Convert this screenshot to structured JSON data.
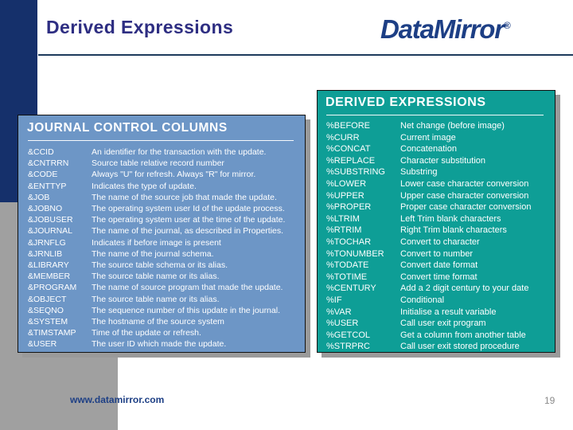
{
  "slide": {
    "title": "Derived Expressions"
  },
  "logo": {
    "name": "DataMirror",
    "registered_mark": "®",
    "color": "#1d3f85"
  },
  "journal_panel": {
    "title": "JOURNAL CONTROL COLUMNS",
    "background_color": "#6d96c6",
    "rows": [
      {
        "key": "&CCID",
        "desc": "An identifier for the transaction with the update."
      },
      {
        "key": "&CNTRRN",
        "desc": "Source table relative record number"
      },
      {
        "key": "&CODE",
        "desc": "Always \"U\" for refresh. Always \"R\" for mirror."
      },
      {
        "key": "&ENTTYP",
        "desc": "Indicates the type of update."
      },
      {
        "key": "&JOB",
        "desc": "The name of the source job that made the update."
      },
      {
        "key": "&JOBNO",
        "desc": "The operating system user Id of the update process."
      },
      {
        "key": "&JOBUSER",
        "desc": "The operating system user at the time of the update."
      },
      {
        "key": "&JOURNAL",
        "desc": "The name of the journal, as described in Properties."
      },
      {
        "key": "&JRNFLG",
        "desc": "Indicates if before image is present"
      },
      {
        "key": "&JRNLIB",
        "desc": "The name of the journal schema."
      },
      {
        "key": "&LIBRARY",
        "desc": "The source table schema or its alias."
      },
      {
        "key": "&MEMBER",
        "desc": "The source table name or its alias."
      },
      {
        "key": "&PROGRAM",
        "desc": "The name of source program that made the update."
      },
      {
        "key": "&OBJECT",
        "desc": "The source table name or its alias."
      },
      {
        "key": "&SEQNO",
        "desc": "The sequence number of this update in the journal."
      },
      {
        "key": "&SYSTEM",
        "desc": "The hostname of the source system"
      },
      {
        "key": "&TIMSTAMP",
        "desc": "Time of the update or refresh."
      },
      {
        "key": "&USER",
        "desc": "The user ID which made the update."
      }
    ]
  },
  "derived_panel": {
    "title": "DERIVED EXPRESSIONS",
    "background_color": "#0e9e96",
    "rows": [
      {
        "key": "%BEFORE",
        "desc": "Net change (before image)"
      },
      {
        "key": "%CURR",
        "desc": "Current image"
      },
      {
        "key": "%CONCAT",
        "desc": "Concatenation"
      },
      {
        "key": "%REPLACE",
        "desc": "Character substitution"
      },
      {
        "key": "%SUBSTRING",
        "desc": "Substring"
      },
      {
        "key": "%LOWER",
        "desc": "Lower case character conversion"
      },
      {
        "key": "%UPPER",
        "desc": "Upper case character conversion"
      },
      {
        "key": "%PROPER",
        "desc": "Proper case character conversion"
      },
      {
        "key": "%LTRIM",
        "desc": "Left Trim blank characters"
      },
      {
        "key": "%RTRIM",
        "desc": "Right Trim blank characters"
      },
      {
        "key": "%TOCHAR",
        "desc": "Convert to character"
      },
      {
        "key": "%TONUMBER",
        "desc": "Convert to number"
      },
      {
        "key": "%TODATE",
        "desc": "Convert date format"
      },
      {
        "key": "%TOTIME",
        "desc": "Convert time format"
      },
      {
        "key": "%CENTURY",
        "desc": "Add a 2 digit century to your date"
      },
      {
        "key": "%IF",
        "desc": "Conditional"
      },
      {
        "key": "%VAR",
        "desc": "Initialise a result variable"
      },
      {
        "key": "%USER",
        "desc": "Call user exit program"
      },
      {
        "key": "%GETCOL",
        "desc": "Get a column from another table"
      },
      {
        "key": "%STRPRC",
        "desc": "Call user exit stored procedure"
      }
    ]
  },
  "footer": {
    "url": "www.datamirror.com",
    "page_number": "19"
  }
}
